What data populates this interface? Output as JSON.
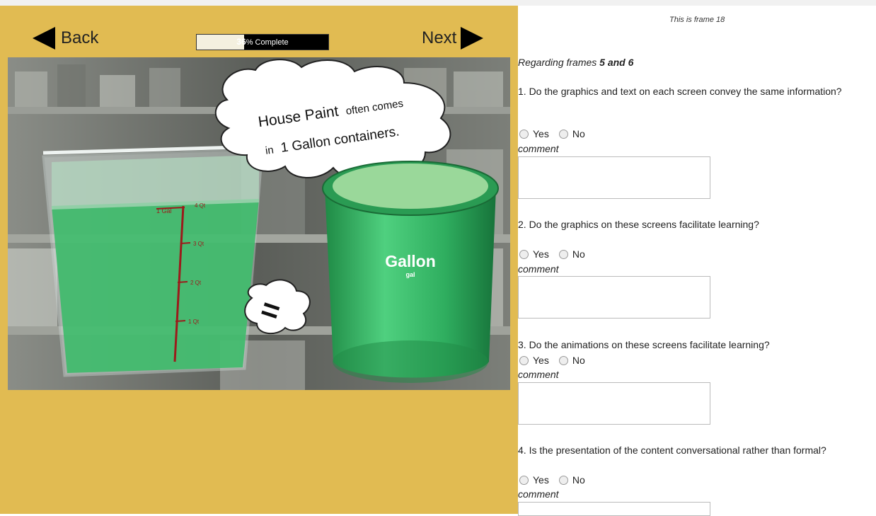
{
  "nav": {
    "back_label": "Back",
    "next_label": "Next",
    "progress_percent": 36,
    "progress_number": "36",
    "progress_suffix": "% Complete"
  },
  "scene": {
    "cloud_line1_a": "House Paint",
    "cloud_line1_b": "often comes",
    "cloud_line2_a": "in",
    "cloud_line2_b": "1 Gallon containers.",
    "measure_labels": [
      "1 Gal",
      "4 Qt",
      "3 Qt",
      "2 Qt",
      "1 Qt"
    ],
    "equals_sign": "=",
    "can_label": "Gallon",
    "can_sublabel": "gal"
  },
  "survey": {
    "frame_label": "This is frame 18",
    "regarding_prefix": "Regarding frames ",
    "regarding_frames": "5 and 6",
    "yes_label": "Yes",
    "no_label": "No",
    "comment_label": "comment",
    "questions": [
      {
        "text": "1. Do the graphics and text on each screen convey the same information?"
      },
      {
        "text": "2. Do the graphics on these screens facilitate learning?"
      },
      {
        "text": "3. Do the animations on these screens facilitate learning?"
      },
      {
        "text": "4. Is the presentation of the content conversational rather than formal?"
      }
    ]
  },
  "colors": {
    "panel_bg": "#e1bb52",
    "paint_green": "#3dbb6a",
    "can_lid": "#9ad89a",
    "ruler_red": "#9b1b1b"
  }
}
